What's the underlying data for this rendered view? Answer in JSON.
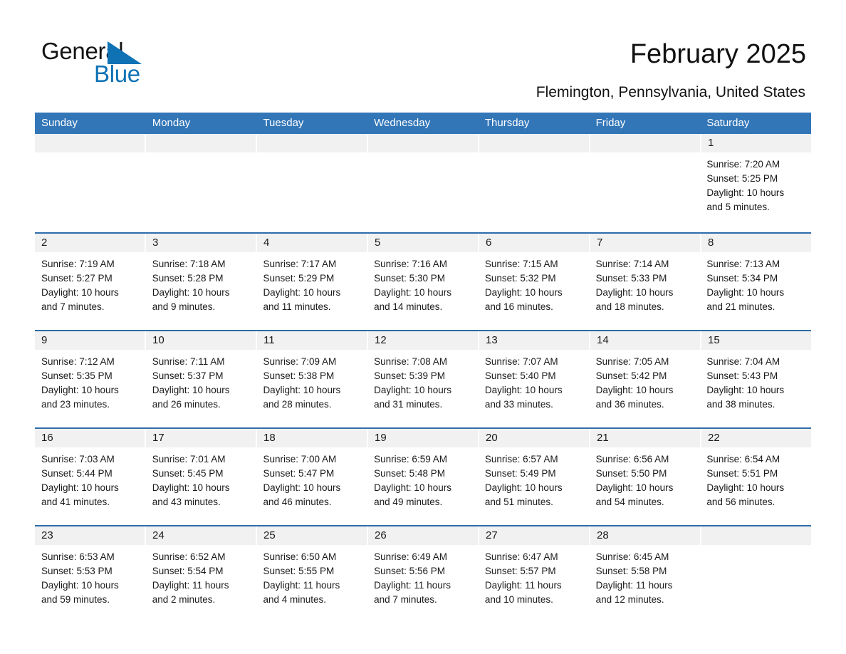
{
  "brand": {
    "name_part1": "General",
    "name_part2": "Blue",
    "triangle_color": "#0E72B5",
    "text_color": "#141414",
    "blue_color": "#0E72B5"
  },
  "header": {
    "title": "February 2025",
    "location": "Flemington, Pennsylvania, United States"
  },
  "theme": {
    "header_blue": "#3276B8",
    "divider_blue": "#2E6DA9",
    "daynum_band": "#F1F1F1",
    "text": "#1a1a1a"
  },
  "weekdays": [
    "Sunday",
    "Monday",
    "Tuesday",
    "Wednesday",
    "Thursday",
    "Friday",
    "Saturday"
  ],
  "weeks": [
    {
      "days": [
        {
          "num": "",
          "sunrise": "",
          "sunset": "",
          "daylight1": "",
          "daylight2": ""
        },
        {
          "num": "",
          "sunrise": "",
          "sunset": "",
          "daylight1": "",
          "daylight2": ""
        },
        {
          "num": "",
          "sunrise": "",
          "sunset": "",
          "daylight1": "",
          "daylight2": ""
        },
        {
          "num": "",
          "sunrise": "",
          "sunset": "",
          "daylight1": "",
          "daylight2": ""
        },
        {
          "num": "",
          "sunrise": "",
          "sunset": "",
          "daylight1": "",
          "daylight2": ""
        },
        {
          "num": "",
          "sunrise": "",
          "sunset": "",
          "daylight1": "",
          "daylight2": ""
        },
        {
          "num": "1",
          "sunrise": "Sunrise: 7:20 AM",
          "sunset": "Sunset: 5:25 PM",
          "daylight1": "Daylight: 10 hours",
          "daylight2": "and 5 minutes."
        }
      ]
    },
    {
      "days": [
        {
          "num": "2",
          "sunrise": "Sunrise: 7:19 AM",
          "sunset": "Sunset: 5:27 PM",
          "daylight1": "Daylight: 10 hours",
          "daylight2": "and 7 minutes."
        },
        {
          "num": "3",
          "sunrise": "Sunrise: 7:18 AM",
          "sunset": "Sunset: 5:28 PM",
          "daylight1": "Daylight: 10 hours",
          "daylight2": "and 9 minutes."
        },
        {
          "num": "4",
          "sunrise": "Sunrise: 7:17 AM",
          "sunset": "Sunset: 5:29 PM",
          "daylight1": "Daylight: 10 hours",
          "daylight2": "and 11 minutes."
        },
        {
          "num": "5",
          "sunrise": "Sunrise: 7:16 AM",
          "sunset": "Sunset: 5:30 PM",
          "daylight1": "Daylight: 10 hours",
          "daylight2": "and 14 minutes."
        },
        {
          "num": "6",
          "sunrise": "Sunrise: 7:15 AM",
          "sunset": "Sunset: 5:32 PM",
          "daylight1": "Daylight: 10 hours",
          "daylight2": "and 16 minutes."
        },
        {
          "num": "7",
          "sunrise": "Sunrise: 7:14 AM",
          "sunset": "Sunset: 5:33 PM",
          "daylight1": "Daylight: 10 hours",
          "daylight2": "and 18 minutes."
        },
        {
          "num": "8",
          "sunrise": "Sunrise: 7:13 AM",
          "sunset": "Sunset: 5:34 PM",
          "daylight1": "Daylight: 10 hours",
          "daylight2": "and 21 minutes."
        }
      ]
    },
    {
      "days": [
        {
          "num": "9",
          "sunrise": "Sunrise: 7:12 AM",
          "sunset": "Sunset: 5:35 PM",
          "daylight1": "Daylight: 10 hours",
          "daylight2": "and 23 minutes."
        },
        {
          "num": "10",
          "sunrise": "Sunrise: 7:11 AM",
          "sunset": "Sunset: 5:37 PM",
          "daylight1": "Daylight: 10 hours",
          "daylight2": "and 26 minutes."
        },
        {
          "num": "11",
          "sunrise": "Sunrise: 7:09 AM",
          "sunset": "Sunset: 5:38 PM",
          "daylight1": "Daylight: 10 hours",
          "daylight2": "and 28 minutes."
        },
        {
          "num": "12",
          "sunrise": "Sunrise: 7:08 AM",
          "sunset": "Sunset: 5:39 PM",
          "daylight1": "Daylight: 10 hours",
          "daylight2": "and 31 minutes."
        },
        {
          "num": "13",
          "sunrise": "Sunrise: 7:07 AM",
          "sunset": "Sunset: 5:40 PM",
          "daylight1": "Daylight: 10 hours",
          "daylight2": "and 33 minutes."
        },
        {
          "num": "14",
          "sunrise": "Sunrise: 7:05 AM",
          "sunset": "Sunset: 5:42 PM",
          "daylight1": "Daylight: 10 hours",
          "daylight2": "and 36 minutes."
        },
        {
          "num": "15",
          "sunrise": "Sunrise: 7:04 AM",
          "sunset": "Sunset: 5:43 PM",
          "daylight1": "Daylight: 10 hours",
          "daylight2": "and 38 minutes."
        }
      ]
    },
    {
      "days": [
        {
          "num": "16",
          "sunrise": "Sunrise: 7:03 AM",
          "sunset": "Sunset: 5:44 PM",
          "daylight1": "Daylight: 10 hours",
          "daylight2": "and 41 minutes."
        },
        {
          "num": "17",
          "sunrise": "Sunrise: 7:01 AM",
          "sunset": "Sunset: 5:45 PM",
          "daylight1": "Daylight: 10 hours",
          "daylight2": "and 43 minutes."
        },
        {
          "num": "18",
          "sunrise": "Sunrise: 7:00 AM",
          "sunset": "Sunset: 5:47 PM",
          "daylight1": "Daylight: 10 hours",
          "daylight2": "and 46 minutes."
        },
        {
          "num": "19",
          "sunrise": "Sunrise: 6:59 AM",
          "sunset": "Sunset: 5:48 PM",
          "daylight1": "Daylight: 10 hours",
          "daylight2": "and 49 minutes."
        },
        {
          "num": "20",
          "sunrise": "Sunrise: 6:57 AM",
          "sunset": "Sunset: 5:49 PM",
          "daylight1": "Daylight: 10 hours",
          "daylight2": "and 51 minutes."
        },
        {
          "num": "21",
          "sunrise": "Sunrise: 6:56 AM",
          "sunset": "Sunset: 5:50 PM",
          "daylight1": "Daylight: 10 hours",
          "daylight2": "and 54 minutes."
        },
        {
          "num": "22",
          "sunrise": "Sunrise: 6:54 AM",
          "sunset": "Sunset: 5:51 PM",
          "daylight1": "Daylight: 10 hours",
          "daylight2": "and 56 minutes."
        }
      ]
    },
    {
      "days": [
        {
          "num": "23",
          "sunrise": "Sunrise: 6:53 AM",
          "sunset": "Sunset: 5:53 PM",
          "daylight1": "Daylight: 10 hours",
          "daylight2": "and 59 minutes."
        },
        {
          "num": "24",
          "sunrise": "Sunrise: 6:52 AM",
          "sunset": "Sunset: 5:54 PM",
          "daylight1": "Daylight: 11 hours",
          "daylight2": "and 2 minutes."
        },
        {
          "num": "25",
          "sunrise": "Sunrise: 6:50 AM",
          "sunset": "Sunset: 5:55 PM",
          "daylight1": "Daylight: 11 hours",
          "daylight2": "and 4 minutes."
        },
        {
          "num": "26",
          "sunrise": "Sunrise: 6:49 AM",
          "sunset": "Sunset: 5:56 PM",
          "daylight1": "Daylight: 11 hours",
          "daylight2": "and 7 minutes."
        },
        {
          "num": "27",
          "sunrise": "Sunrise: 6:47 AM",
          "sunset": "Sunset: 5:57 PM",
          "daylight1": "Daylight: 11 hours",
          "daylight2": "and 10 minutes."
        },
        {
          "num": "28",
          "sunrise": "Sunrise: 6:45 AM",
          "sunset": "Sunset: 5:58 PM",
          "daylight1": "Daylight: 11 hours",
          "daylight2": "and 12 minutes."
        },
        {
          "num": "",
          "sunrise": "",
          "sunset": "",
          "daylight1": "",
          "daylight2": ""
        }
      ]
    }
  ]
}
